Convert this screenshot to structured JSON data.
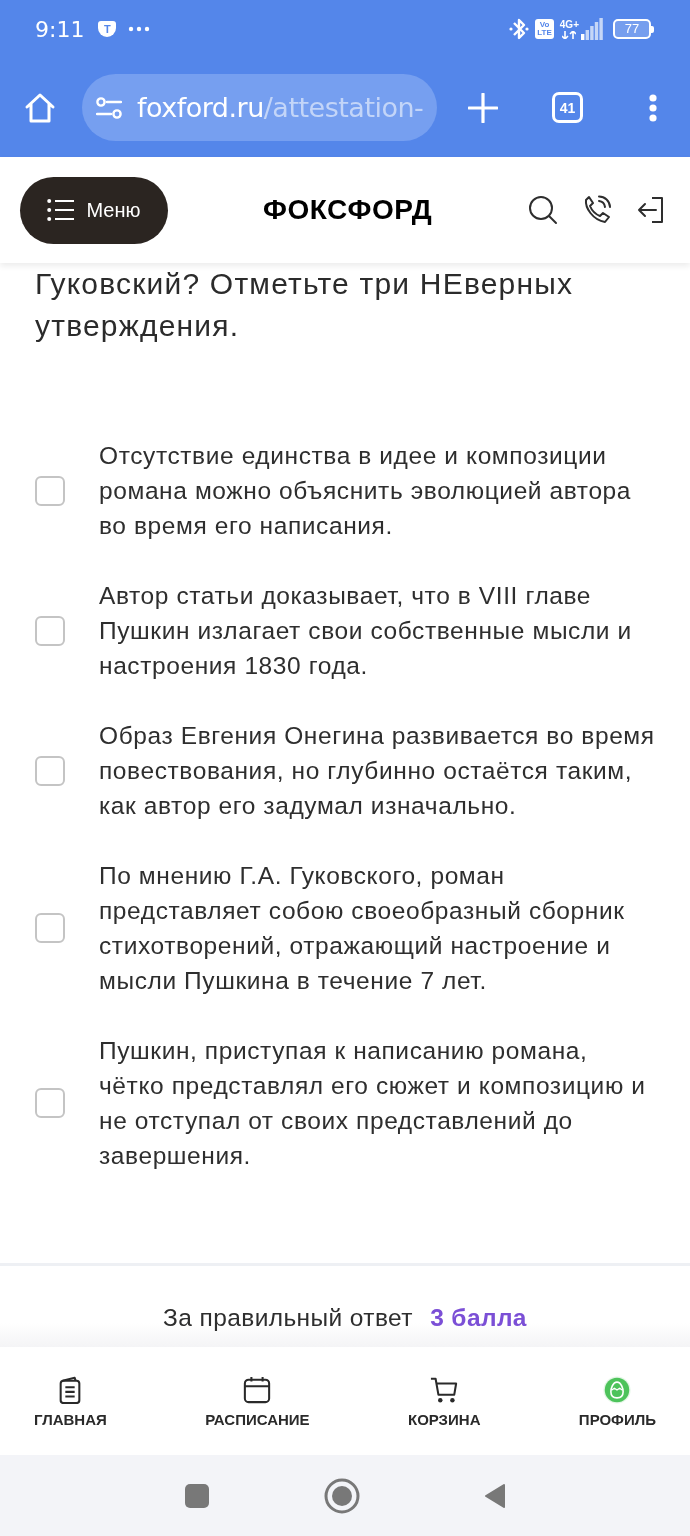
{
  "status_bar": {
    "time": "9:11",
    "notification_badge": "T",
    "volte_top": "Vo",
    "volte_bottom": "LTE",
    "network_type": "4G+",
    "battery": "77"
  },
  "browser": {
    "url_host": "foxford.ru",
    "url_path": "/attestation-",
    "tab_count": "41"
  },
  "site_header": {
    "menu_label": "Меню",
    "logo": "ФОКСФОРД"
  },
  "question": "Гуковский? Отметьте три НЕверных утверждения.",
  "options": [
    {
      "text": "Отсутствие единства в идее и композиции романа можно объяснить эволюцией автора во время его написания.",
      "checked": false
    },
    {
      "text": "Автор статьи доказывает, что в VIII главе Пушкин излагает свои собственные мысли и настроения 1830 года.",
      "checked": false
    },
    {
      "text": "Образ Евгения Онегина развивается во время повествования, но глубинно остаётся таким, как автор его задумал изначально.",
      "checked": false
    },
    {
      "text": "По мнению Г.А. Гуковского, роман представляет собою своеобразный сборник стихотворений, отражающий настроение и мысли Пушкина в течение 7 лет.",
      "checked": false
    },
    {
      "text": "Пушкин, приступая к написанию романа, чётко представлял его сюжет и композицию и не отступал от своих представлений до завершения.",
      "checked": false
    }
  ],
  "score": {
    "label": "За правильный ответ",
    "points": "3 балла"
  },
  "bottom_nav": [
    {
      "label": "ГЛАВНАЯ"
    },
    {
      "label": "РАСПИСАНИЕ"
    },
    {
      "label": "КОРЗИНА"
    },
    {
      "label": "ПРОФИЛЬ"
    }
  ]
}
